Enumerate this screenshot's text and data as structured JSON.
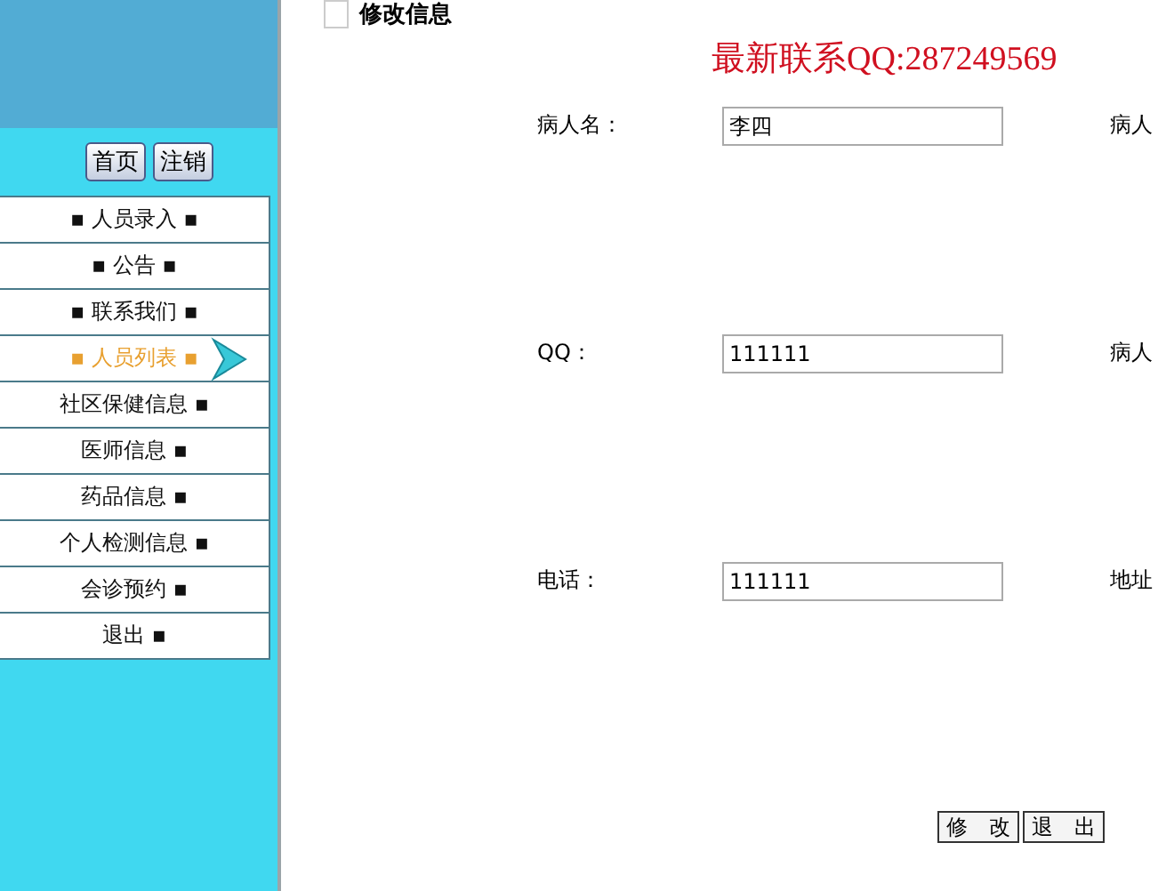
{
  "top_buttons": [
    "首页",
    "注销"
  ],
  "menu": [
    {
      "label": "▪ 人员录入 ▪",
      "selected": false
    },
    {
      "label": "▪ 公告 ▪",
      "selected": false
    },
    {
      "label": "▪ 联系我们 ▪",
      "selected": false
    },
    {
      "label": "▪ 人员列表 ▪",
      "selected": true
    },
    {
      "label": "社区保健信息 ▪",
      "selected": false
    },
    {
      "label": "医师信息 ▪",
      "selected": false
    },
    {
      "label": "药品信息 ▪",
      "selected": false
    },
    {
      "label": "个人检测信息 ▪",
      "selected": false
    },
    {
      "label": "会诊预约 ▪",
      "selected": false
    },
    {
      "label": "退出 ▪",
      "selected": false
    }
  ],
  "section": {
    "title": "修改信息",
    "checked": false
  },
  "contact_notice": "最新联系QQ:287249569",
  "form_rows": [
    {
      "label": "病人名：",
      "value": "李四",
      "right_label": "病人"
    },
    {
      "label": "QQ：",
      "value": "111111",
      "right_label": "病人"
    },
    {
      "label": "电话：",
      "value": "111111",
      "right_label": "地址"
    }
  ],
  "actions": [
    "修　改",
    "退　出"
  ]
}
